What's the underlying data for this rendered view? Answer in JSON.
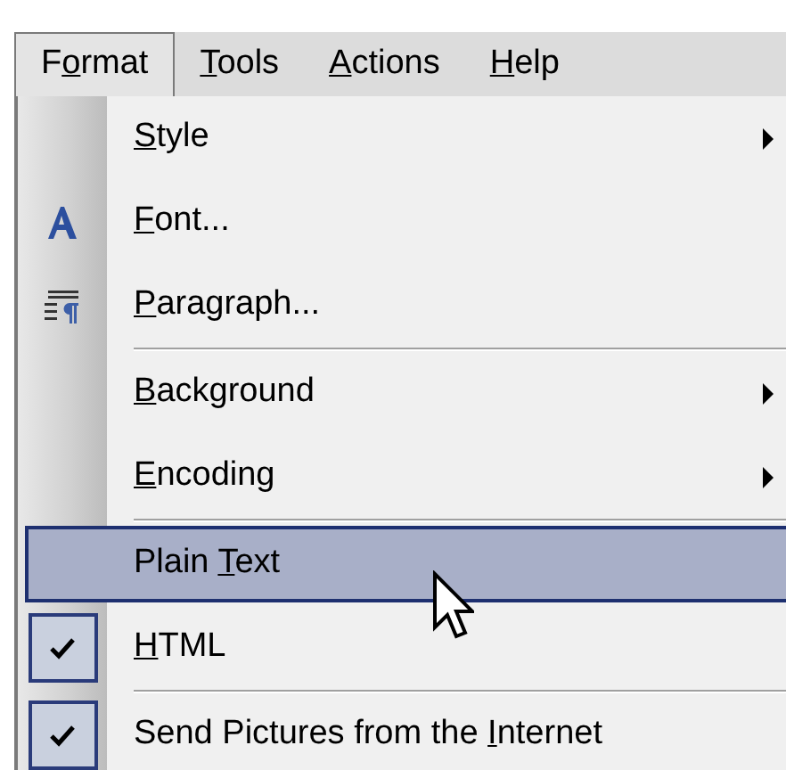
{
  "menubar": [
    {
      "lead": "F",
      "key": "o",
      "rest": "rmat",
      "selected": true
    },
    {
      "key": "T",
      "rest": "ools",
      "selected": false
    },
    {
      "key": "A",
      "rest": "ctions",
      "selected": false
    },
    {
      "key": "H",
      "rest": "elp",
      "selected": false
    }
  ],
  "menu": {
    "groups": [
      [
        {
          "key": "S",
          "rest": "tyle",
          "kind": "submenu",
          "selected": false
        },
        {
          "key": "F",
          "rest": "ont...",
          "kind": "font",
          "selected": false
        },
        {
          "key": "P",
          "rest": "aragraph...",
          "kind": "paragraph",
          "selected": false
        }
      ],
      [
        {
          "key": "B",
          "rest": "ackground",
          "kind": "submenu",
          "selected": false
        },
        {
          "key": "E",
          "rest": "ncoding",
          "kind": "submenu",
          "selected": false
        }
      ],
      [
        {
          "lead": "Plain ",
          "key": "T",
          "rest": "ext",
          "kind": "toggle",
          "checked": false,
          "selected": true
        },
        {
          "key": "H",
          "rest": "TML",
          "kind": "toggle",
          "checked": true,
          "selected": false
        }
      ],
      [
        {
          "lead": "Send Pictures from the ",
          "key": "I",
          "rest": "nternet",
          "kind": "toggle",
          "checked": true,
          "selected": false
        }
      ]
    ]
  }
}
